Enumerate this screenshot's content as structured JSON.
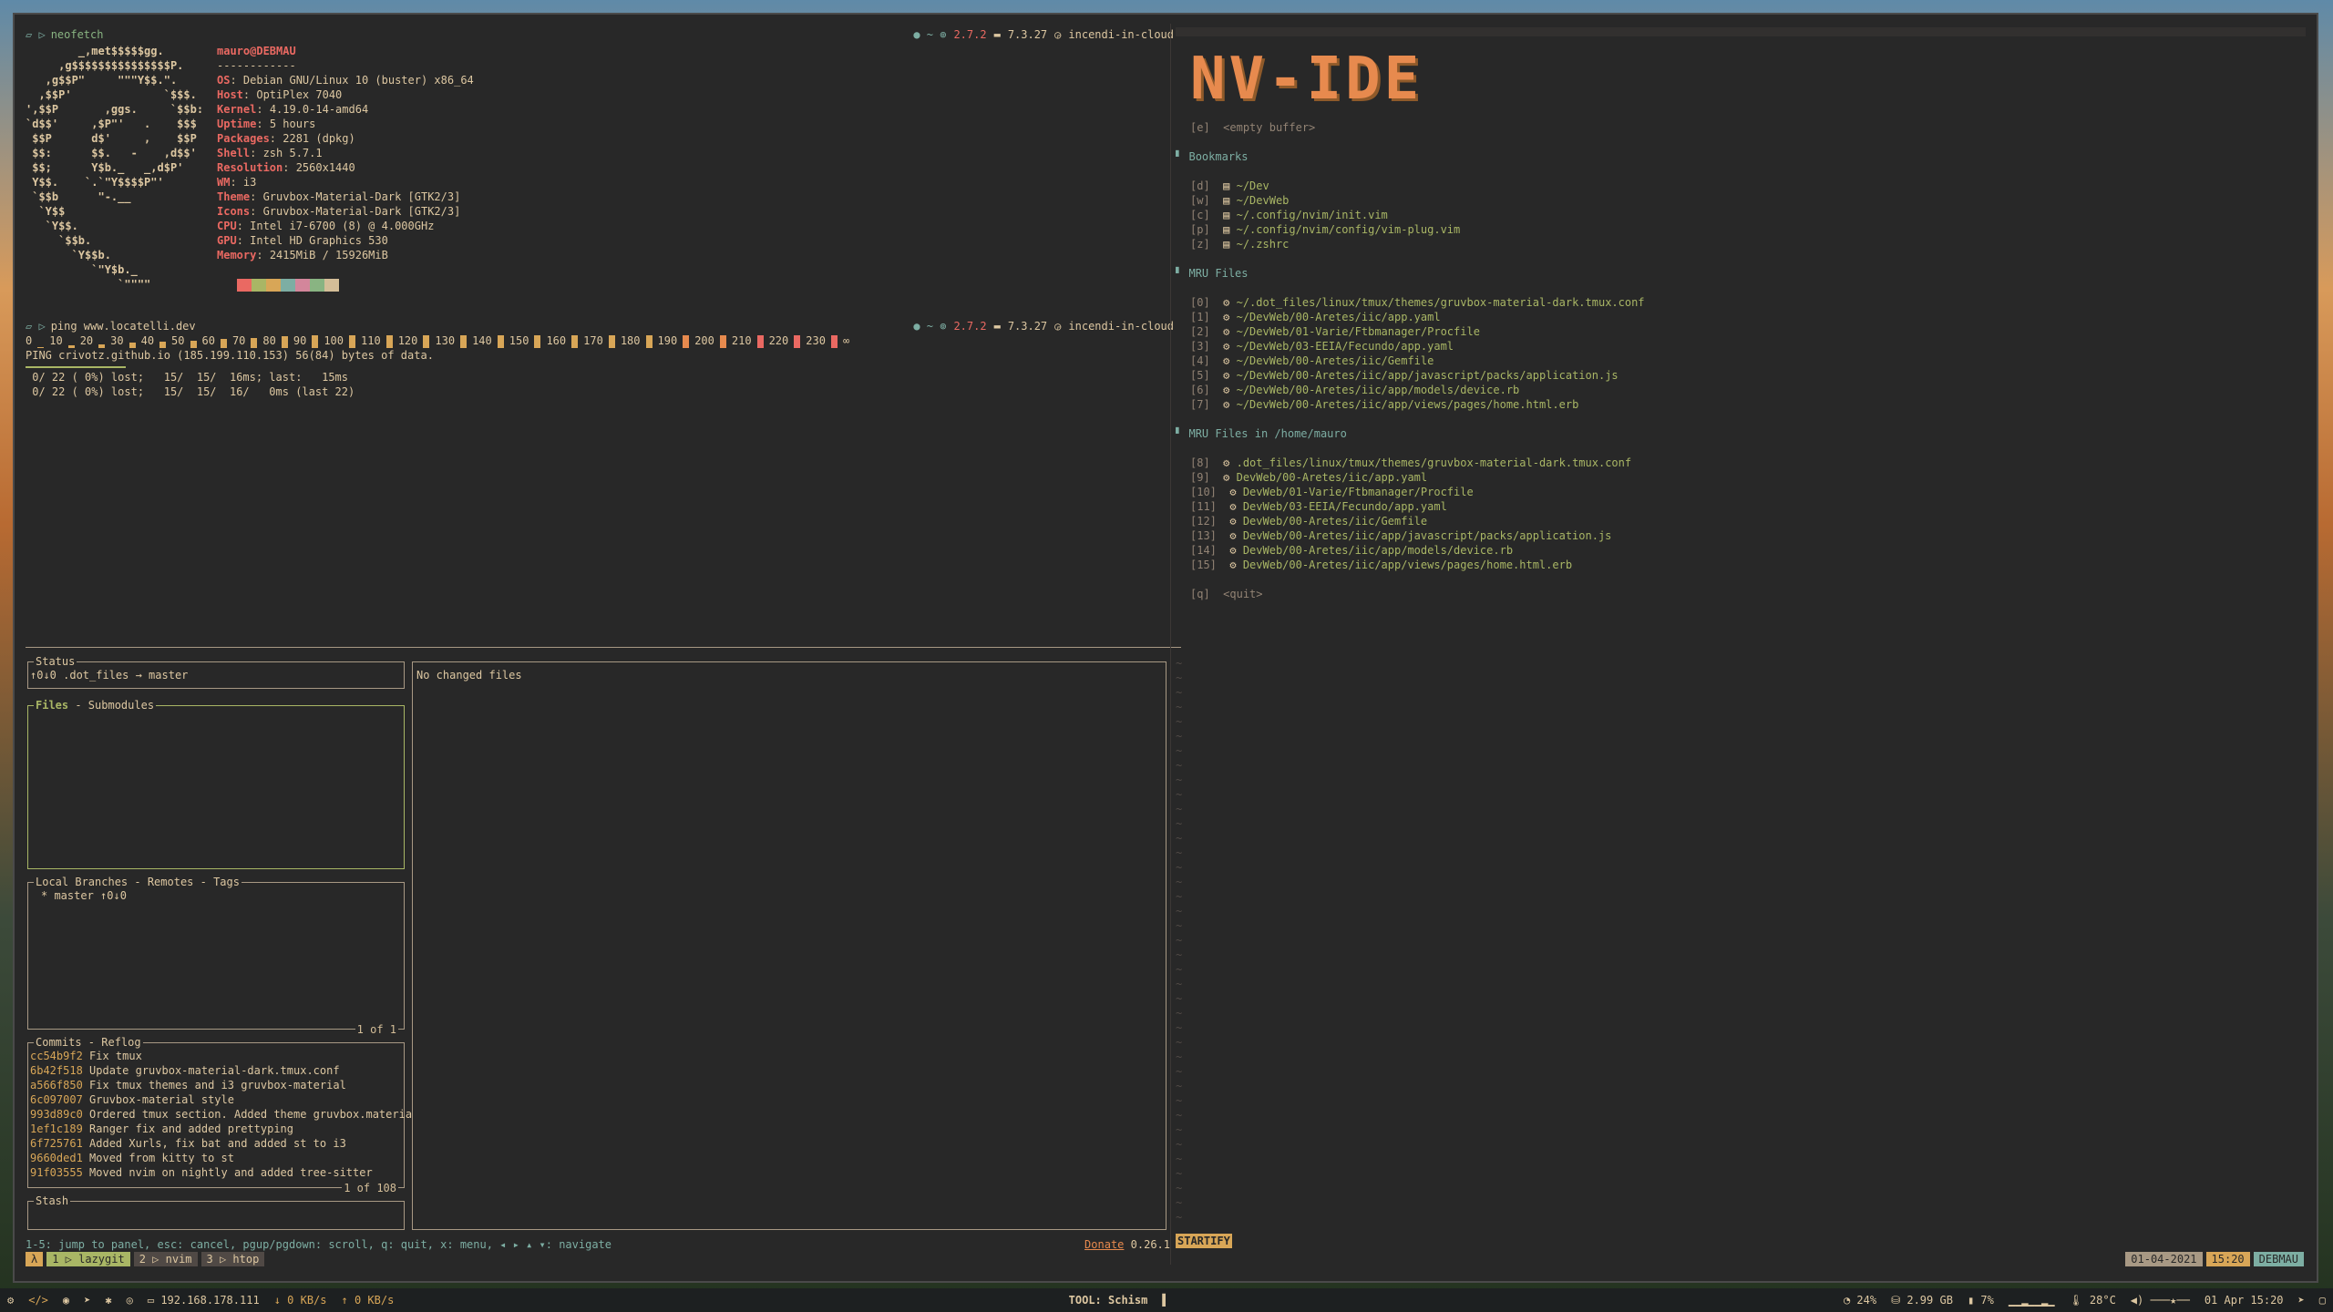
{
  "top_left_pane": {
    "prompt_cmd": "neofetch",
    "prompt_right": {
      "ruby": "2.7.2",
      "node": "7.3.27",
      "context": "incendi-in-cloud"
    },
    "logo_lines": [
      "        _,met$$$$$gg.",
      "     ,g$$$$$$$$$$$$$$$P.",
      "   ,g$$P\"     \"\"\"Y$$.\".",
      "  ,$$P'              `$$$.",
      "',$$P       ,ggs.     `$$b:",
      "`d$$'     ,$P\"'   .    $$$",
      " $$P      d$'     ,    $$P",
      " $$:      $$.   -    ,d$$'",
      " $$;      Y$b._   _,d$P'",
      " Y$$.    `.`\"Y$$$$P\"'",
      " `$$b      \"-.__",
      "  `Y$$",
      "   `Y$$.",
      "     `$$b.",
      "       `Y$$b.",
      "          `\"Y$b._",
      "              `\"\"\"\""
    ],
    "user": "mauro@DEBMAU",
    "separator": "------------",
    "info": [
      {
        "k": "OS",
        "v": "Debian GNU/Linux 10 (buster) x86_64"
      },
      {
        "k": "Host",
        "v": "OptiPlex 7040"
      },
      {
        "k": "Kernel",
        "v": "4.19.0-14-amd64"
      },
      {
        "k": "Uptime",
        "v": "5 hours"
      },
      {
        "k": "Packages",
        "v": "2281 (dpkg)"
      },
      {
        "k": "Shell",
        "v": "zsh 5.7.1"
      },
      {
        "k": "Resolution",
        "v": "2560x1440"
      },
      {
        "k": "WM",
        "v": "i3"
      },
      {
        "k": "Theme",
        "v": "Gruvbox-Material-Dark [GTK2/3]"
      },
      {
        "k": "Icons",
        "v": "Gruvbox-Material-Dark [GTK2/3]"
      },
      {
        "k": "CPU",
        "v": "Intel i7-6700 (8) @ 4.000GHz"
      },
      {
        "k": "GPU",
        "v": "Intel HD Graphics 530"
      },
      {
        "k": "Memory",
        "v": "2415MiB / 15926MiB"
      }
    ],
    "palette": [
      "#ea6962",
      "#a9b665",
      "#d8a657",
      "#7daea3",
      "#d3869b",
      "#89b482",
      "#d4be98"
    ]
  },
  "ping_pane": {
    "prompt_cmd": "ping www.locatelli.dev",
    "prompt_right": {
      "ruby": "2.7.2",
      "node": "7.3.27",
      "context": "incendi-in-cloud"
    },
    "scale_labels": [
      "0",
      "10",
      "20",
      "30",
      "40",
      "50",
      "60",
      "70",
      "80",
      "90",
      "100",
      "110",
      "120",
      "130",
      "140",
      "150",
      "160",
      "170",
      "180",
      "190",
      "200",
      "210",
      "220",
      "230",
      "∞"
    ],
    "bar_levels": [
      0.1,
      0.2,
      0.3,
      0.4,
      0.5,
      0.6,
      0.7,
      0.8,
      0.9,
      1,
      1,
      1,
      1,
      1,
      1,
      1,
      1,
      1,
      1,
      1,
      1,
      1,
      1,
      1
    ],
    "ping_line": "PING crivotz.github.io (185.199.110.153) 56(84) bytes of data.",
    "stats": [
      " 0/ 22 ( 0%) lost;   15/  15/  16ms; last:   15ms",
      " 0/ 22 ( 0%) lost;   15/  15/  16/   0ms (last 22)"
    ]
  },
  "lazygit": {
    "status_title": "Status",
    "status_value": "↑0↓0 .dot_files → master",
    "files_title": "Files",
    "files_title_rest": " - Submodules",
    "branches_title": "Local Branches - Remotes - Tags",
    "branches": [
      "* master ↑0↓0"
    ],
    "branches_footer": "1 of 1",
    "commits_title": "Commits - Reflog",
    "commits": [
      {
        "hash": "cc54b9f2",
        "msg": "Fix tmux"
      },
      {
        "hash": "6b42f518",
        "msg": "Update gruvbox-material-dark.tmux.conf"
      },
      {
        "hash": "a566f850",
        "msg": "Fix tmux themes and i3 gruvbox-material"
      },
      {
        "hash": "6c097007",
        "msg": "Gruvbox-material style"
      },
      {
        "hash": "993d89c0",
        "msg": "Ordered tmux section. Added theme gruvbox.materia"
      },
      {
        "hash": "1ef1c189",
        "msg": "Ranger fix and added prettyping"
      },
      {
        "hash": "6f725761",
        "msg": "Added Xurls, fix bat and added st to i3"
      },
      {
        "hash": "9660ded1",
        "msg": "Moved from kitty to st"
      },
      {
        "hash": "91f03555",
        "msg": "Moved nvim on nightly and added tree-sitter"
      }
    ],
    "commits_footer": "1 of 108",
    "stash_title": "Stash",
    "main_text": "No changed files",
    "help": "1-5: jump to panel, esc: cancel, pgup/pgdown: scroll, q: quit, x: menu, ◂ ▸ ▴ ▾: navigate",
    "donate": "Donate",
    "version": "0.26.1"
  },
  "nvim": {
    "header": "NV-IDE",
    "empty_key": "[e]",
    "empty_label": "<empty buffer>",
    "bookmarks_title": "Bookmarks",
    "bookmarks": [
      {
        "key": "[d]",
        "path": "~/Dev"
      },
      {
        "key": "[w]",
        "path": "~/DevWeb"
      },
      {
        "key": "[c]",
        "path": "~/.config/nvim/init.vim"
      },
      {
        "key": "[p]",
        "path": "~/.config/nvim/config/vim-plug.vim"
      },
      {
        "key": "[z]",
        "path": "~/.zshrc"
      }
    ],
    "mru_title": "MRU Files",
    "mru": [
      {
        "key": "[0]",
        "path": "~/.dot_files/linux/tmux/themes/gruvbox-material-dark.tmux.conf"
      },
      {
        "key": "[1]",
        "path": "~/DevWeb/00-Aretes/iic/app.yaml"
      },
      {
        "key": "[2]",
        "path": "~/DevWeb/01-Varie/Ftbmanager/Procfile"
      },
      {
        "key": "[3]",
        "path": "~/DevWeb/03-EEIA/Fecundo/app.yaml"
      },
      {
        "key": "[4]",
        "path": "~/DevWeb/00-Aretes/iic/Gemfile"
      },
      {
        "key": "[5]",
        "path": "~/DevWeb/00-Aretes/iic/app/javascript/packs/application.js"
      },
      {
        "key": "[6]",
        "path": "~/DevWeb/00-Aretes/iic/app/models/device.rb"
      },
      {
        "key": "[7]",
        "path": "~/DevWeb/00-Aretes/iic/app/views/pages/home.html.erb"
      }
    ],
    "mru_home_title": "MRU Files in /home/mauro",
    "mru_home": [
      {
        "key": "[8]",
        "path": ".dot_files/linux/tmux/themes/gruvbox-material-dark.tmux.conf"
      },
      {
        "key": "[9]",
        "path": "DevWeb/00-Aretes/iic/app.yaml"
      },
      {
        "key": "[10]",
        "path": "DevWeb/01-Varie/Ftbmanager/Procfile"
      },
      {
        "key": "[11]",
        "path": "DevWeb/03-EEIA/Fecundo/app.yaml"
      },
      {
        "key": "[12]",
        "path": "DevWeb/00-Aretes/iic/Gemfile"
      },
      {
        "key": "[13]",
        "path": "DevWeb/00-Aretes/iic/app/javascript/packs/application.js"
      },
      {
        "key": "[14]",
        "path": "DevWeb/00-Aretes/iic/app/models/device.rb"
      },
      {
        "key": "[15]",
        "path": "DevWeb/00-Aretes/iic/app/views/pages/home.html.erb"
      }
    ],
    "quit_key": "[q]",
    "quit_label": "<quit>",
    "mode_label": "STARTIFY"
  },
  "tmux_status": {
    "session": "λ",
    "windows": [
      {
        "label": "1 ▷ lazygit",
        "active": true
      },
      {
        "label": "2 ▷ nvim",
        "active": false
      },
      {
        "label": "3 ▷ htop",
        "active": false
      }
    ],
    "date": "01-04-2021",
    "time": "15:20",
    "host": "DEBMAU"
  },
  "i3bar": {
    "ip": "192.168.178.111",
    "down": "0 KB/s",
    "up": "0 KB/s",
    "window_title": "TOOL: Schism",
    "cpu": "24%",
    "disk": "2.99 GB",
    "mem": "7%",
    "temp": "28°C",
    "datetime": "01 Apr 15:20"
  }
}
